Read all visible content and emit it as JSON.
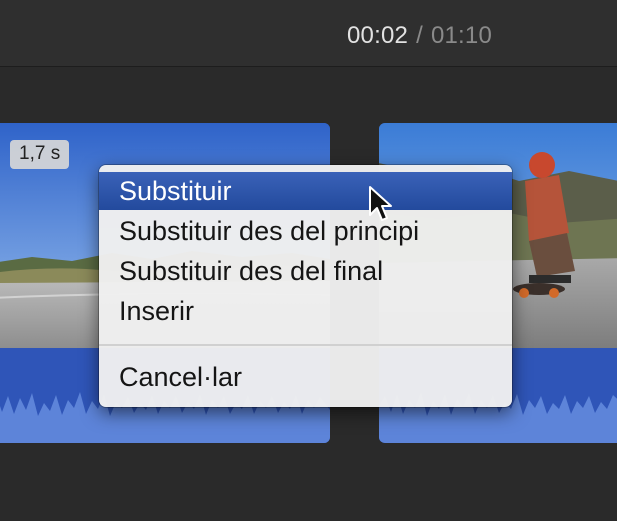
{
  "header": {
    "current_time": "00:02",
    "separator": "/",
    "total_time": "01:10"
  },
  "clips": {
    "left_duration": "1,7 s"
  },
  "context_menu": {
    "items": [
      {
        "label": "Substituir",
        "selected": true
      },
      {
        "label": "Substituir des del principi",
        "selected": false
      },
      {
        "label": "Substituir des del final",
        "selected": false
      },
      {
        "label": "Inserir",
        "selected": false
      },
      {
        "label": "Cancel·lar",
        "selected": false
      }
    ]
  },
  "colors": {
    "clip_blue": "#2f55b8",
    "selection_blue": "#234a9d",
    "background": "#2c2c2c"
  },
  "icons": {
    "cursor": "arrow-cursor-icon"
  }
}
